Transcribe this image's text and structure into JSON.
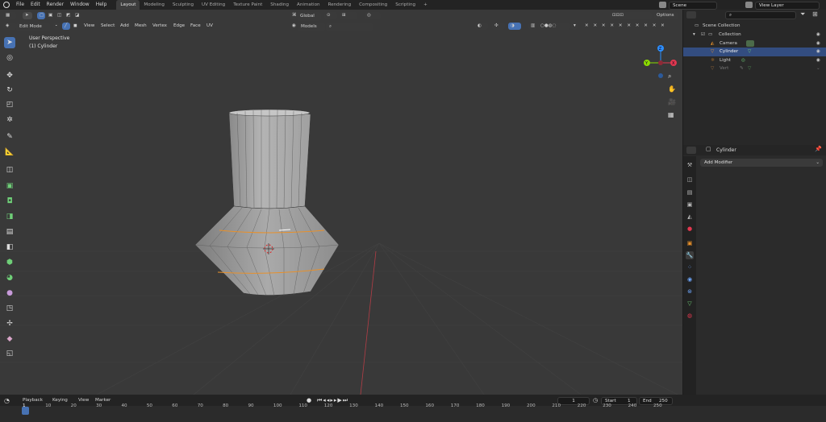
{
  "topbar": {
    "menus": [
      "File",
      "Edit",
      "Render",
      "Window",
      "Help"
    ],
    "tabs": [
      {
        "label": "Layout",
        "active": true
      },
      {
        "label": "Modeling"
      },
      {
        "label": "Sculpting"
      },
      {
        "label": "UV Editing"
      },
      {
        "label": "Texture Paint"
      },
      {
        "label": "Shading"
      },
      {
        "label": "Animation"
      },
      {
        "label": "Rendering"
      },
      {
        "label": "Compositing"
      },
      {
        "label": "Scripting"
      }
    ],
    "add_tab": "+",
    "scene": "Scene",
    "view_layer": "View Layer"
  },
  "viewport_header": {
    "mode": "Edit Mode",
    "menus": [
      "View",
      "Select",
      "Add",
      "Mesh",
      "Vertex",
      "Edge",
      "Face",
      "UV"
    ],
    "orientation": "Global",
    "models": "Models",
    "options": "Options"
  },
  "overlay": {
    "perspective": "User Perspective",
    "object": "(1) Cylinder"
  },
  "gizmo": {
    "x": "X",
    "y": "Y",
    "z": "Z"
  },
  "outliner": {
    "root": "Scene Collection",
    "collection": "Collection",
    "items": [
      {
        "name": "Camera",
        "selected": false
      },
      {
        "name": "Cylinder",
        "selected": true
      },
      {
        "name": "Light",
        "selected": false
      },
      {
        "name": "Vert",
        "selected": false
      }
    ]
  },
  "properties": {
    "object_name": "Cylinder",
    "add_modifier": "Add Modifier"
  },
  "timeline": {
    "menus": [
      "Playback",
      "Keying",
      "View",
      "Marker"
    ],
    "current_frame": "1",
    "start_label": "Start",
    "start": "1",
    "end_label": "End",
    "end": "250",
    "ruler_frames": [
      "1",
      "10",
      "20",
      "30",
      "40",
      "50",
      "60",
      "70",
      "80",
      "90",
      "100",
      "110",
      "120",
      "130",
      "140",
      "150",
      "160",
      "170",
      "180",
      "190",
      "200",
      "210",
      "220",
      "230",
      "240",
      "250"
    ]
  },
  "colors": {
    "accent": "#4772b3",
    "edge_selected": "#e8902a",
    "axis_x": "#e2384f",
    "axis_y": "#8bdc00",
    "axis_z": "#2c8fff"
  }
}
